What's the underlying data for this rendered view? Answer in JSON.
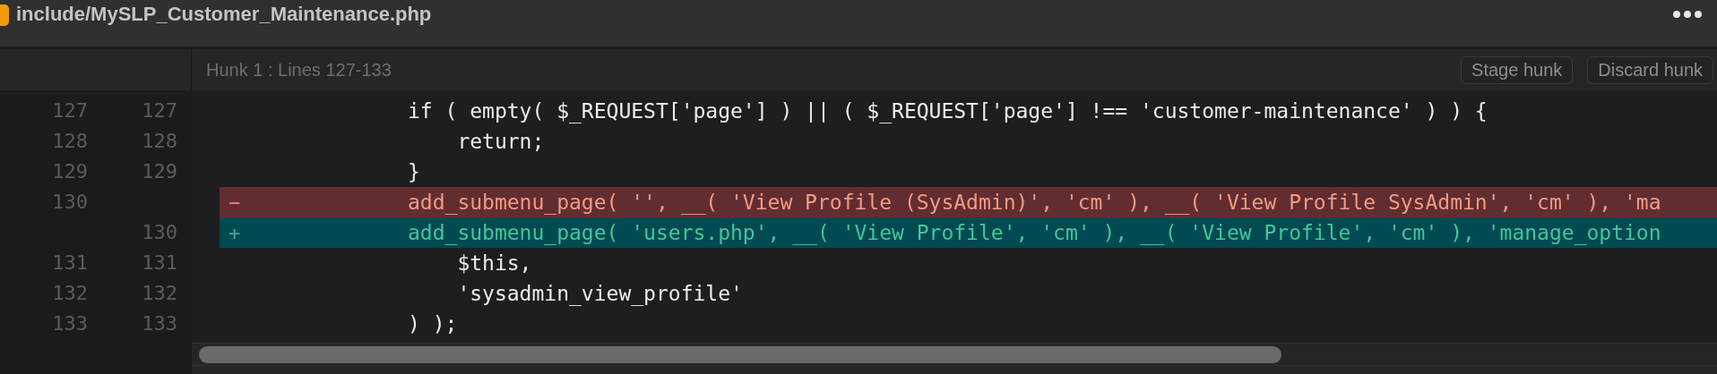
{
  "file": {
    "path": "include/MySLP_Customer_Maintenance.php"
  },
  "hunk": {
    "title": "Hunk 1 : Lines 127-133",
    "buttons": [
      "Stage hunk",
      "Discard hunk"
    ]
  },
  "lines": [
    {
      "kind": "context",
      "old": "127",
      "new": "127",
      "text": "if ( empty( $_REQUEST['page'] ) || ( $_REQUEST['page'] !== 'customer-maintenance' ) ) {"
    },
    {
      "kind": "context",
      "old": "128",
      "new": "128",
      "text": "    return;"
    },
    {
      "kind": "context",
      "old": "129",
      "new": "129",
      "text": "}"
    },
    {
      "kind": "removed",
      "old": "130",
      "marker": "−",
      "text": "add_submenu_page( '', __( 'View Profile (SysAdmin)', 'cm' ), __( 'View Profile SysAdmin', 'cm' ), 'ma"
    },
    {
      "kind": "added",
      "new": "130",
      "marker": "+",
      "text": "add_submenu_page( 'users.php', __( 'View Profile', 'cm' ), __( 'View Profile', 'cm' ), 'manage_option"
    },
    {
      "kind": "context",
      "old": "131",
      "new": "131",
      "text": "    $this,"
    },
    {
      "kind": "context",
      "old": "132",
      "new": "132",
      "text": "    'sysadmin_view_profile'"
    },
    {
      "kind": "context",
      "old": "133",
      "new": "133",
      "text": ") );"
    }
  ]
}
